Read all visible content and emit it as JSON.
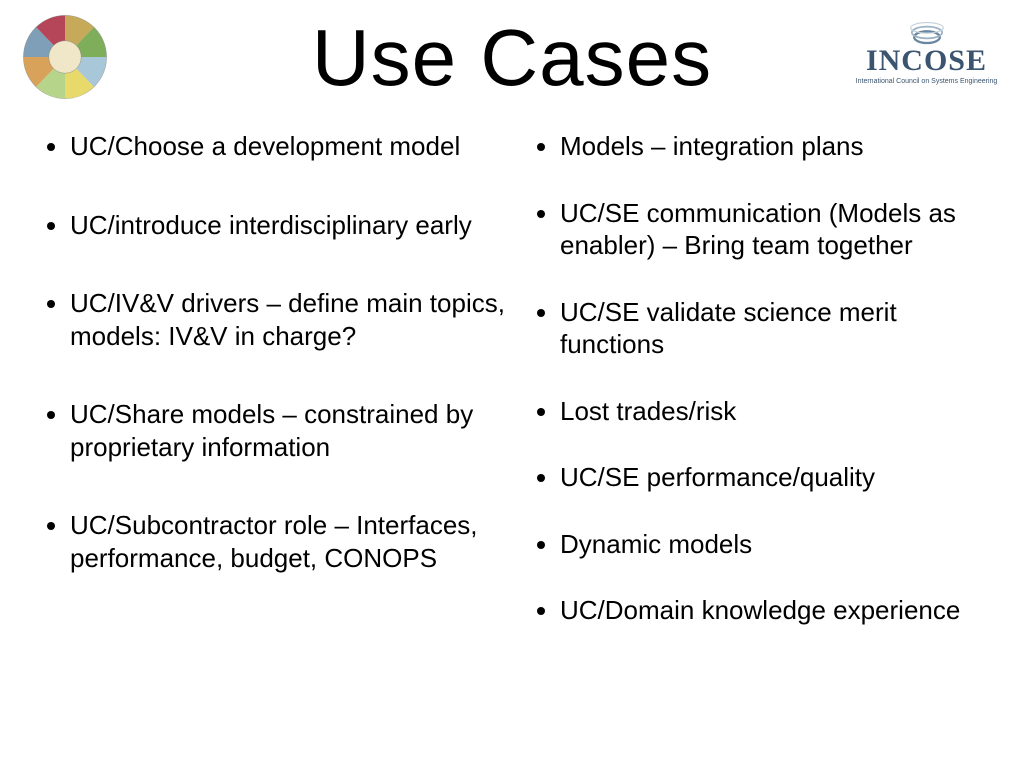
{
  "title": "Use Cases",
  "logo_right": {
    "word": "INCOSE",
    "subtitle": "International Council on Systems Engineering"
  },
  "left_bullets": [
    "UC/Choose a development model",
    "UC/introduce interdisciplinary early",
    "UC/IV&V drivers – define main topics, models: IV&V in charge?",
    "UC/Share models – constrained by proprietary information",
    "UC/Subcontractor role – Interfaces, performance, budget, CONOPS"
  ],
  "right_bullets": [
    "Models – integration plans",
    "UC/SE communication (Models as enabler) – Bring team together",
    "UC/SE validate science merit functions",
    "Lost trades/risk",
    "UC/SE performance/quality",
    "Dynamic models",
    "UC/Domain knowledge experience"
  ]
}
